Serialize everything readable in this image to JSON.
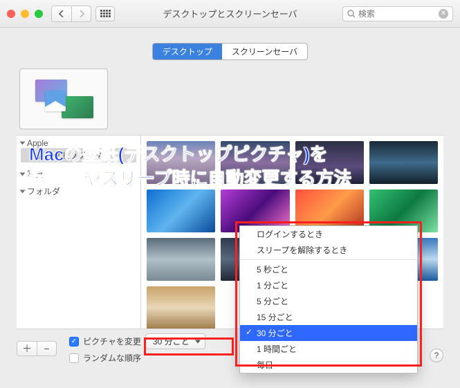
{
  "window": {
    "title": "デスクトップとスクリーンセーバ",
    "search_placeholder": "検索"
  },
  "tabs": {
    "desktop": "デスクトップ",
    "screensaver": "スクリーンセーバ"
  },
  "preview_label": "",
  "sidebar": {
    "group_apple": "Apple",
    "items": {
      "desktop_pictures": "デスクトップピクチ…"
    },
    "group_photos": "写真",
    "group_folders": "フォルダ"
  },
  "bottom": {
    "change_picture_label": "ピクチャを変更",
    "change_picture_selected": "30 分ごと",
    "random_label": "ランダムな順序"
  },
  "menu": {
    "login": "ログインするとき",
    "wake": "スリープを解除するとき",
    "s5": "5 秒ごと",
    "m1": "1 分ごと",
    "m5": "5 分ごと",
    "m15": "15 分ごと",
    "m30": "30 分ごと",
    "h1": "1 時間ごと",
    "daily": "毎日"
  },
  "overlay": {
    "line1": "Macの壁紙(デスクトップピクチャ)を",
    "line2": "起動時やスリープ時に自動変更する方法"
  }
}
